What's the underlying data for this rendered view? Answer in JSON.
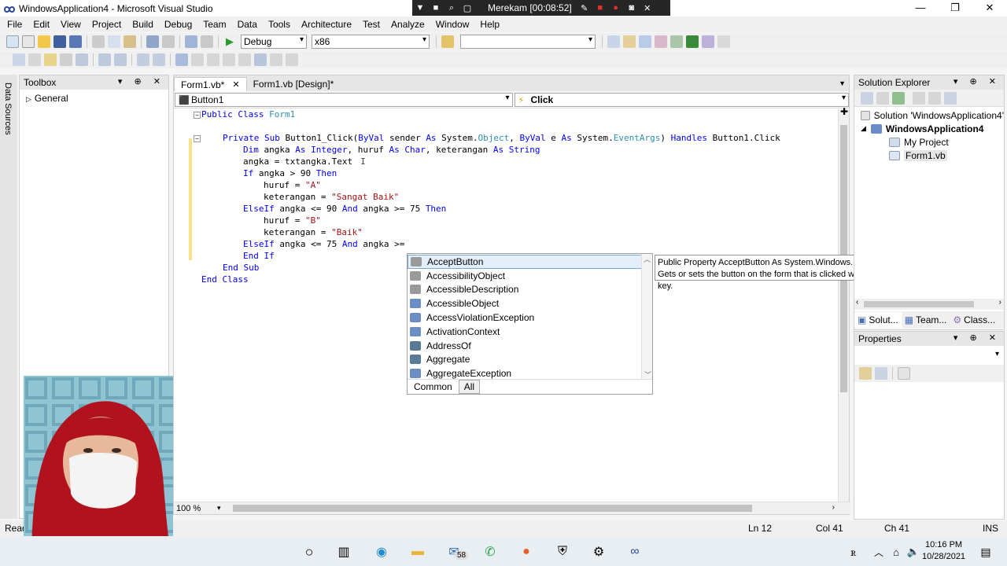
{
  "window": {
    "title": "WindowsApplication4 - Microsoft Visual Studio",
    "min_glyph": "—",
    "max_glyph": "❐",
    "close_glyph": "✕"
  },
  "recorder": {
    "label": "Merekam [00:08:52]",
    "icons": [
      "chevron-down-icon",
      "stop-icon",
      "zoom-icon",
      "screen-icon",
      "pen-icon",
      "record-icon",
      "record-icon",
      "camera-icon",
      "close-icon"
    ]
  },
  "menu": [
    "File",
    "Edit",
    "View",
    "Project",
    "Build",
    "Debug",
    "Team",
    "Data",
    "Tools",
    "Architecture",
    "Test",
    "Analyze",
    "Window",
    "Help"
  ],
  "toolbar": {
    "config": "Debug",
    "platform": "x86",
    "find": ""
  },
  "left_strip": {
    "label": "Data Sources"
  },
  "toolbox": {
    "title": "Toolbox",
    "group": "General",
    "header_buttons": "▾ ⊕ ✕"
  },
  "editor": {
    "tabs": [
      {
        "label": "Form1.vb*",
        "active": true
      },
      {
        "label": "Form1.vb [Design]*",
        "active": false
      }
    ],
    "object_combo": "Button1",
    "event_combo": "Click",
    "zoom": "100 %"
  },
  "code": {
    "l1": [
      "Public Class",
      " Form1"
    ],
    "l2": [
      "Private Sub",
      " Button1_Click(",
      "ByVal",
      " sender ",
      "As",
      " System.",
      "Object",
      ", ",
      "ByVal",
      " e ",
      "As",
      " System.",
      "EventArgs",
      ") ",
      "Handles",
      " Button1.Click"
    ],
    "l3": [
      "Dim",
      " angka ",
      "As",
      " ",
      "Integer",
      ", huruf ",
      "As",
      " ",
      "Char",
      ", keterangan ",
      "As",
      " ",
      "String"
    ],
    "l4": "angka = txtangka.Text",
    "l5": [
      "If",
      " angka > 90 ",
      "Then"
    ],
    "l6": [
      "huruf = ",
      "\"A\""
    ],
    "l7": [
      "keterangan = ",
      "\"Sangat Baik\""
    ],
    "l8": [
      "ElseIf",
      " angka <= 90 ",
      "And",
      " angka >= 75 ",
      "Then"
    ],
    "l9": [
      "huruf = ",
      "\"B\""
    ],
    "l10": [
      "keterangan = ",
      "\"Baik\""
    ],
    "l11": [
      "ElseIf",
      " angka <= 75 ",
      "And",
      " angka >="
    ],
    "l12": "End If",
    "l13": "End Sub",
    "l14": "End Class"
  },
  "intellisense": {
    "items": [
      {
        "label": "AcceptButton",
        "icon": "property-icon",
        "color": "#9a9a9a"
      },
      {
        "label": "AccessibilityObject",
        "icon": "property-icon",
        "color": "#9a9a9a"
      },
      {
        "label": "AccessibleDescription",
        "icon": "property-icon",
        "color": "#9a9a9a"
      },
      {
        "label": "AccessibleObject",
        "icon": "class-icon",
        "color": "#6b8fc4"
      },
      {
        "label": "AccessViolationException",
        "icon": "class-icon",
        "color": "#6b8fc4"
      },
      {
        "label": "ActivationContext",
        "icon": "class-icon",
        "color": "#6b8fc4"
      },
      {
        "label": "AddressOf",
        "icon": "keyword-icon",
        "color": "#5a7a9a"
      },
      {
        "label": "Aggregate",
        "icon": "keyword-icon",
        "color": "#5a7a9a"
      },
      {
        "label": "AggregateException",
        "icon": "class-icon",
        "color": "#6b8fc4"
      }
    ],
    "tab_common": "Common",
    "tab_all": "All"
  },
  "tooltip": {
    "line1": "Public Property AcceptButton As System.Windows.Forms.IButtonControl",
    "line2": "Gets or sets the button on the form that is clicked when the user presses the ENTER key."
  },
  "solution_explorer": {
    "title": "Solution Explorer",
    "solution": "Solution 'WindowsApplication4'",
    "project": "WindowsApplication4",
    "my_project": "My Project",
    "file": "Form1.vb",
    "tabs": [
      "Solut...",
      "Team...",
      "Class..."
    ]
  },
  "properties": {
    "title": "Properties"
  },
  "statusbar": {
    "ready": "Ready",
    "ln": "Ln 12",
    "col": "Col 41",
    "ch": "Ch 41",
    "ins": "INS"
  },
  "taskbar": {
    "mail_badge": "58",
    "time": "10:16 PM",
    "date": "10/28/2021"
  },
  "colors": {
    "keyword": "#0000ff",
    "type": "#2b91af",
    "string": "#a31515"
  }
}
